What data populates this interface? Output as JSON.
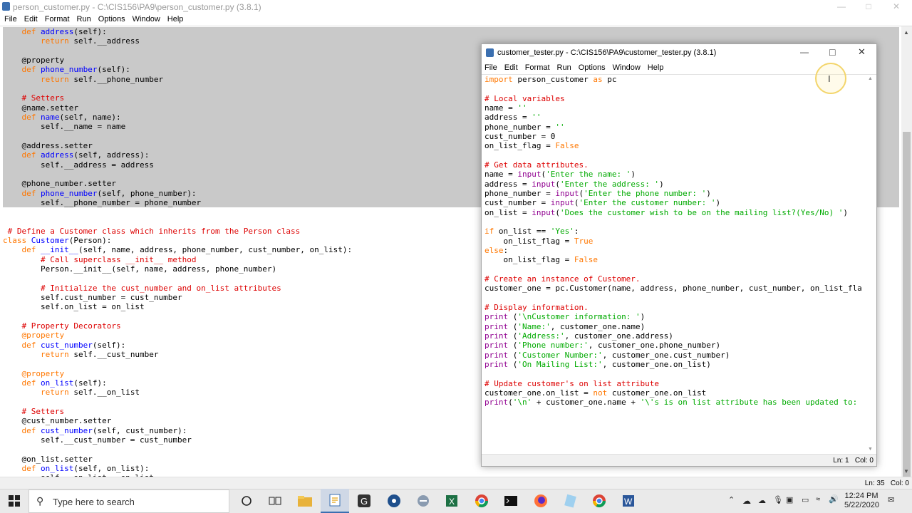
{
  "main_window": {
    "title": "person_customer.py - C:\\CIS156\\PA9\\person_customer.py (3.8.1)",
    "menu": [
      "File",
      "Edit",
      "Format",
      "Run",
      "Options",
      "Window",
      "Help"
    ],
    "status": "Ln: 35   Col: 0",
    "selected_lines": [
      [
        [
          "    ",
          ""
        ],
        [
          "def ",
          "kw"
        ],
        [
          "address",
          "df"
        ],
        [
          "(self):",
          ""
        ]
      ],
      [
        [
          "        ",
          ""
        ],
        [
          "return ",
          "kw"
        ],
        [
          "self.__address",
          ""
        ]
      ],
      [
        [
          "",
          ""
        ]
      ],
      [
        [
          "    @property",
          ""
        ]
      ],
      [
        [
          "    ",
          ""
        ],
        [
          "def ",
          "kw"
        ],
        [
          "phone_number",
          "df"
        ],
        [
          "(self):",
          ""
        ]
      ],
      [
        [
          "        ",
          ""
        ],
        [
          "return ",
          "kw"
        ],
        [
          "self.__phone_number",
          ""
        ]
      ],
      [
        [
          "",
          ""
        ]
      ],
      [
        [
          "    ",
          ""
        ],
        [
          "# Setters",
          "cm"
        ]
      ],
      [
        [
          "    @name.setter",
          ""
        ]
      ],
      [
        [
          "    ",
          ""
        ],
        [
          "def ",
          "kw"
        ],
        [
          "name",
          "df"
        ],
        [
          "(self, name):",
          ""
        ]
      ],
      [
        [
          "        self.__name = name",
          ""
        ]
      ],
      [
        [
          "",
          ""
        ]
      ],
      [
        [
          "    @address.setter",
          ""
        ]
      ],
      [
        [
          "    ",
          ""
        ],
        [
          "def ",
          "kw"
        ],
        [
          "address",
          "df"
        ],
        [
          "(self, address):",
          ""
        ]
      ],
      [
        [
          "        self.__address = address",
          ""
        ]
      ],
      [
        [
          "",
          ""
        ]
      ],
      [
        [
          "    @phone_number.setter",
          ""
        ]
      ],
      [
        [
          "    ",
          ""
        ],
        [
          "def ",
          "kw"
        ],
        [
          "phone_number",
          "df"
        ],
        [
          "(self, phone_number):",
          ""
        ]
      ],
      [
        [
          "        self.__phone_number = phone_number",
          ""
        ]
      ]
    ],
    "lines": [
      [
        [
          "",
          ""
        ]
      ],
      [
        [
          "",
          ""
        ]
      ],
      [
        [
          " # Define a Customer class which inherits from the Person class",
          "cm"
        ]
      ],
      [
        [
          "class ",
          "kw"
        ],
        [
          "Customer",
          "df"
        ],
        [
          "(Person):",
          ""
        ]
      ],
      [
        [
          "    ",
          ""
        ],
        [
          "def ",
          "kw"
        ],
        [
          "__init__",
          "df"
        ],
        [
          "(self, name, address, phone_number, cust_number, on_list):",
          ""
        ]
      ],
      [
        [
          "        ",
          ""
        ],
        [
          "# Call superclass __init__ method",
          "cm"
        ]
      ],
      [
        [
          "        Person.__init__(self, name, address, phone_number)",
          ""
        ]
      ],
      [
        [
          "",
          ""
        ]
      ],
      [
        [
          "        ",
          ""
        ],
        [
          "# Initialize the cust_number and on_list attributes",
          "cm"
        ]
      ],
      [
        [
          "        self.cust_number = cust_number",
          ""
        ]
      ],
      [
        [
          "        self.on_list = on_list",
          ""
        ]
      ],
      [
        [
          "",
          ""
        ]
      ],
      [
        [
          "    ",
          ""
        ],
        [
          "# Property Decorators",
          "cm"
        ]
      ],
      [
        [
          "    ",
          ""
        ],
        [
          "@property",
          "kw"
        ]
      ],
      [
        [
          "    ",
          ""
        ],
        [
          "def ",
          "kw"
        ],
        [
          "cust_number",
          "df"
        ],
        [
          "(self):",
          ""
        ]
      ],
      [
        [
          "        ",
          ""
        ],
        [
          "return ",
          "kw"
        ],
        [
          "self.__cust_number",
          ""
        ]
      ],
      [
        [
          "",
          ""
        ]
      ],
      [
        [
          "    ",
          ""
        ],
        [
          "@property",
          "kw"
        ]
      ],
      [
        [
          "    ",
          ""
        ],
        [
          "def ",
          "kw"
        ],
        [
          "on_list",
          "df"
        ],
        [
          "(self):",
          ""
        ]
      ],
      [
        [
          "        ",
          ""
        ],
        [
          "return ",
          "kw"
        ],
        [
          "self.__on_list",
          ""
        ]
      ],
      [
        [
          "",
          ""
        ]
      ],
      [
        [
          "    ",
          ""
        ],
        [
          "# Setters",
          "cm"
        ]
      ],
      [
        [
          "    @cust_number.setter",
          ""
        ]
      ],
      [
        [
          "    ",
          ""
        ],
        [
          "def ",
          "kw"
        ],
        [
          "cust_number",
          "df"
        ],
        [
          "(self, cust_number):",
          ""
        ]
      ],
      [
        [
          "        self.__cust_number = cust_number",
          ""
        ]
      ],
      [
        [
          "",
          ""
        ]
      ],
      [
        [
          "    @on_list.setter",
          ""
        ]
      ],
      [
        [
          "    ",
          ""
        ],
        [
          "def ",
          "kw"
        ],
        [
          "on_list",
          "df"
        ],
        [
          "(self, on_list):",
          ""
        ]
      ],
      [
        [
          "        self.__on_list = on_list",
          ""
        ]
      ]
    ]
  },
  "child_window": {
    "title": "customer_tester.py - C:\\CIS156\\PA9\\customer_tester.py (3.8.1)",
    "menu": [
      "File",
      "Edit",
      "Format",
      "Run",
      "Options",
      "Window",
      "Help"
    ],
    "status": "Ln: 1   Col: 0",
    "lines": [
      [
        [
          "import ",
          "kw"
        ],
        [
          "person_customer ",
          ""
        ],
        [
          "as ",
          "kw"
        ],
        [
          "pc",
          ""
        ]
      ],
      [
        [
          "",
          ""
        ]
      ],
      [
        [
          "# Local variables",
          "cm"
        ]
      ],
      [
        [
          "name = ",
          ""
        ],
        [
          "''",
          "st"
        ]
      ],
      [
        [
          "address = ",
          ""
        ],
        [
          "''",
          "st"
        ]
      ],
      [
        [
          "phone_number = ",
          ""
        ],
        [
          "''",
          "st"
        ]
      ],
      [
        [
          "cust_number = 0",
          ""
        ]
      ],
      [
        [
          "on_list_flag = ",
          ""
        ],
        [
          "False",
          "kw"
        ]
      ],
      [
        [
          "",
          ""
        ]
      ],
      [
        [
          "# Get data attributes.",
          "cm"
        ]
      ],
      [
        [
          "name = ",
          ""
        ],
        [
          "input",
          "bi"
        ],
        [
          "(",
          ""
        ],
        [
          "'Enter the name: '",
          "st"
        ],
        [
          ")",
          ""
        ]
      ],
      [
        [
          "address = ",
          ""
        ],
        [
          "input",
          "bi"
        ],
        [
          "(",
          ""
        ],
        [
          "'Enter the address: '",
          "st"
        ],
        [
          ")",
          ""
        ]
      ],
      [
        [
          "phone_number = ",
          ""
        ],
        [
          "input",
          "bi"
        ],
        [
          "(",
          ""
        ],
        [
          "'Enter the phone number: '",
          "st"
        ],
        [
          ")",
          ""
        ]
      ],
      [
        [
          "cust_number = ",
          ""
        ],
        [
          "input",
          "bi"
        ],
        [
          "(",
          ""
        ],
        [
          "'Enter the customer number: '",
          "st"
        ],
        [
          ")",
          ""
        ]
      ],
      [
        [
          "on_list = ",
          ""
        ],
        [
          "input",
          "bi"
        ],
        [
          "(",
          ""
        ],
        [
          "'Does the customer wish to be on the mailing list?(Yes/No) '",
          "st"
        ],
        [
          ")",
          ""
        ]
      ],
      [
        [
          "",
          ""
        ]
      ],
      [
        [
          "if ",
          "kw"
        ],
        [
          "on_list == ",
          ""
        ],
        [
          "'Yes'",
          "st"
        ],
        [
          ":",
          ""
        ]
      ],
      [
        [
          "    on_list_flag = ",
          ""
        ],
        [
          "True",
          "kw"
        ]
      ],
      [
        [
          "else",
          "kw"
        ],
        [
          ":",
          ""
        ]
      ],
      [
        [
          "    on_list_flag = ",
          ""
        ],
        [
          "False",
          "kw"
        ]
      ],
      [
        [
          "",
          ""
        ]
      ],
      [
        [
          "# Create an instance of Customer.",
          "cm"
        ]
      ],
      [
        [
          "customer_one = pc.Customer(name, address, phone_number, cust_number, on_list_fla",
          ""
        ]
      ],
      [
        [
          "",
          ""
        ]
      ],
      [
        [
          "# Display information.",
          "cm"
        ]
      ],
      [
        [
          "print ",
          "bi"
        ],
        [
          "(",
          ""
        ],
        [
          "'\\nCustomer information: '",
          "st"
        ],
        [
          ")",
          ""
        ]
      ],
      [
        [
          "print ",
          "bi"
        ],
        [
          "(",
          ""
        ],
        [
          "'Name:'",
          "st"
        ],
        [
          ", customer_one.name)",
          ""
        ]
      ],
      [
        [
          "print ",
          "bi"
        ],
        [
          "(",
          ""
        ],
        [
          "'Address:'",
          "st"
        ],
        [
          ", customer_one.address)",
          ""
        ]
      ],
      [
        [
          "print ",
          "bi"
        ],
        [
          "(",
          ""
        ],
        [
          "'Phone number:'",
          "st"
        ],
        [
          ", customer_one.phone_number)",
          ""
        ]
      ],
      [
        [
          "print ",
          "bi"
        ],
        [
          "(",
          ""
        ],
        [
          "'Customer Number:'",
          "st"
        ],
        [
          ", customer_one.cust_number)",
          ""
        ]
      ],
      [
        [
          "print ",
          "bi"
        ],
        [
          "(",
          ""
        ],
        [
          "'On Mailing List:'",
          "st"
        ],
        [
          ", customer_one.on_list)",
          ""
        ]
      ],
      [
        [
          "",
          ""
        ]
      ],
      [
        [
          "# Update customer's on list attribute",
          "cm"
        ]
      ],
      [
        [
          "customer_one.on_list = ",
          ""
        ],
        [
          "not ",
          "kw"
        ],
        [
          "customer_one.on_list",
          ""
        ]
      ],
      [
        [
          "print",
          "bi"
        ],
        [
          "(",
          ""
        ],
        [
          "'\\n'",
          "st"
        ],
        [
          " + customer_one.name + ",
          ""
        ],
        [
          "'\\'s is on list attribute has been updated to: ",
          "st"
        ]
      ]
    ]
  },
  "taskbar": {
    "search_placeholder": "Type here to search",
    "time": "12:24 PM",
    "date": "5/22/2020"
  }
}
